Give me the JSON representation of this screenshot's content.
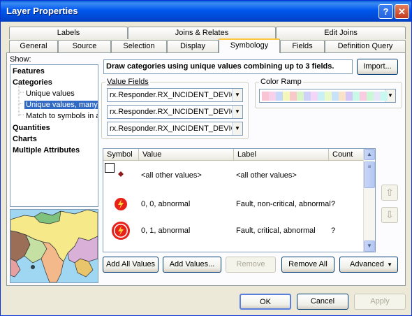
{
  "window": {
    "title": "Layer Properties",
    "help_glyph": "?",
    "close_glyph": "✕"
  },
  "tabs_row1": [
    "Labels",
    "Joins & Relates",
    "Edit Joins"
  ],
  "tabs_row2": [
    "General",
    "Source",
    "Selection",
    "Display",
    "Symbology",
    "Fields",
    "Definition Query"
  ],
  "active_tab": "Symbology",
  "show": {
    "label": "Show:",
    "items": [
      "Features",
      "Categories",
      "Unique values",
      "Unique values, many",
      "Match to symbols in a",
      "Quantities",
      "Charts",
      "Multiple Attributes"
    ]
  },
  "description": "Draw categories using unique values combining up to 3 fields.",
  "import_button": "Import...",
  "value_fields": {
    "label": "Value Fields",
    "fields": [
      "rx.Responder.RX_INCIDENT_DEVIC",
      "rx.Responder.RX_INCIDENT_DEVIC",
      "rx.Responder.RX_INCIDENT_DEVIC"
    ]
  },
  "color_ramp": {
    "label": "Color Ramp",
    "colors": [
      "#f9c5d4",
      "#f9d0ea",
      "#c6d8f9",
      "#f5f6b9",
      "#f9c8c8",
      "#d8f5c8",
      "#cfd1f9",
      "#f3d5f9",
      "#c8f0f5",
      "#e9f9c8",
      "#c8e3f9",
      "#f9e3c8",
      "#d4c8f9",
      "#c8f9e6",
      "#f9cce2",
      "#c8f9d4",
      "#e6e6f9",
      "#c8f9f1"
    ]
  },
  "table": {
    "columns": [
      "Symbol",
      "Value",
      "Label",
      "Count"
    ],
    "rows": [
      {
        "value": "<all other values>",
        "label": "<all other values>",
        "count": ""
      },
      {
        "value": "0, 0, abnormal",
        "label": "Fault, non-critical, abnormal",
        "count": "?"
      },
      {
        "value": "0, 1, abnormal",
        "label": "Fault, critical, abnormal",
        "count": "?"
      }
    ]
  },
  "buttons": {
    "add_all": "Add All Values",
    "add": "Add Values...",
    "remove": "Remove",
    "remove_all": "Remove All",
    "advanced": "Advanced",
    "ok": "OK",
    "cancel": "Cancel",
    "apply": "Apply"
  },
  "colors": {
    "accent": "#316ac5",
    "titlebar": "#0058ee",
    "symbol_red": "#e8201a"
  }
}
